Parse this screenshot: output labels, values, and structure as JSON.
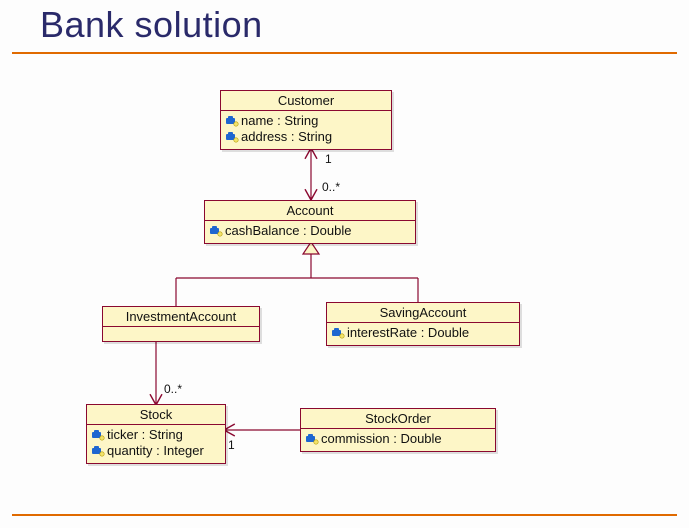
{
  "title": "Bank solution",
  "classes": {
    "customer": {
      "name": "Customer",
      "attrs": [
        "name : String",
        "address : String"
      ]
    },
    "account": {
      "name": "Account",
      "attrs": [
        "cashBalance : Double"
      ]
    },
    "investmentAccount": {
      "name": "InvestmentAccount",
      "attrs": []
    },
    "savingAccount": {
      "name": "SavingAccount",
      "attrs": [
        "interestRate : Double"
      ]
    },
    "stock": {
      "name": "Stock",
      "attrs": [
        "ticker : String",
        "quantity : Integer"
      ]
    },
    "stockOrder": {
      "name": "StockOrder",
      "attrs": [
        "commission : Double"
      ]
    }
  },
  "multiplicities": {
    "custToAcct_cust": "1",
    "custToAcct_acct": "0..*",
    "investToStock_stock": "0..*",
    "stockToOrder_stock": "1"
  },
  "relationships": [
    {
      "from": "Account",
      "to": "Customer",
      "type": "association",
      "fromMult": "0..*",
      "toMult": "1"
    },
    {
      "from": "InvestmentAccount",
      "to": "Account",
      "type": "generalization"
    },
    {
      "from": "SavingAccount",
      "to": "Account",
      "type": "generalization"
    },
    {
      "from": "InvestmentAccount",
      "to": "Stock",
      "type": "association",
      "toMult": "0..*"
    },
    {
      "from": "StockOrder",
      "to": "Stock",
      "type": "association",
      "toMult": "1"
    }
  ]
}
